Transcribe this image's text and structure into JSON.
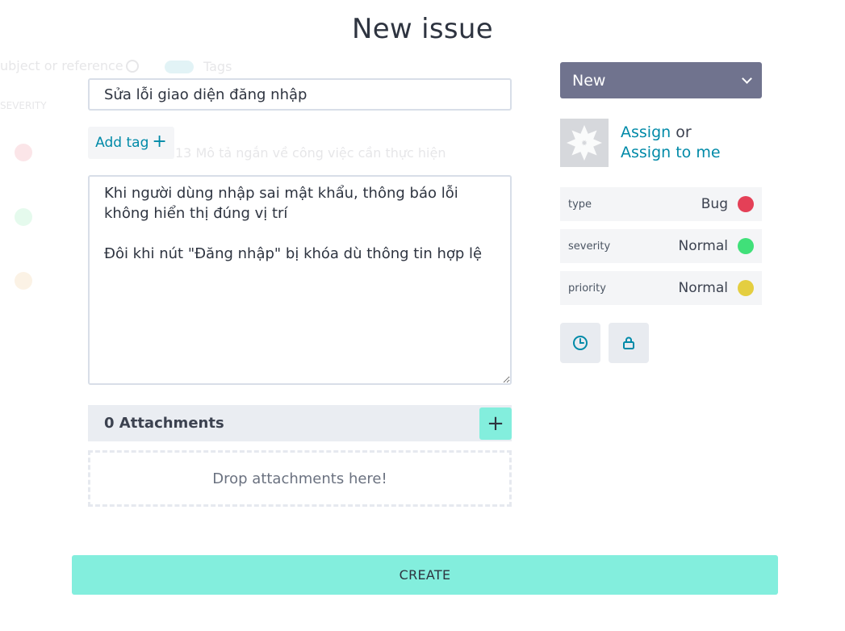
{
  "background": {
    "search_placeholder": "ubject or reference",
    "tags_label": "Tags",
    "severity_header": "SEVERITY",
    "row_text": "13  Mô tả ngắn về công việc cần thực hiện",
    "dot_colors": [
      "#e44057",
      "#40e079",
      "#e4a240"
    ]
  },
  "modal": {
    "title": "New issue",
    "subject_value": "Sửa lỗi giao diện đăng nhập",
    "add_tag_label": "Add tag",
    "description_value": "Khi người dùng nhập sai mật khẩu, thông báo lỗi không hiển thị đúng vị trí\n\nĐôi khi nút \"Đăng nhập\" bị khóa dù thông tin hợp lệ",
    "attachments": {
      "title": "0 Attachments",
      "add_icon": "plus-icon",
      "dropzone_text": "Drop attachments here!"
    },
    "create_label": "CREATE"
  },
  "sidebar": {
    "status": {
      "value": "New",
      "icon": "chevron-down-icon"
    },
    "assign": {
      "assign_label": "Assign",
      "or_label": "or",
      "assign_to_me_label": "Assign to me"
    },
    "attributes": [
      {
        "label": "type",
        "value": "Bug",
        "color": "#e44057"
      },
      {
        "label": "severity",
        "value": "Normal",
        "color": "#40e079"
      },
      {
        "label": "priority",
        "value": "Normal",
        "color": "#e4ce40"
      }
    ],
    "icon_buttons": [
      "clock-icon",
      "lock-icon"
    ]
  },
  "colors": {
    "accent": "#008aa8",
    "primary_button": "#83eedd",
    "status_bg": "#70738e"
  }
}
